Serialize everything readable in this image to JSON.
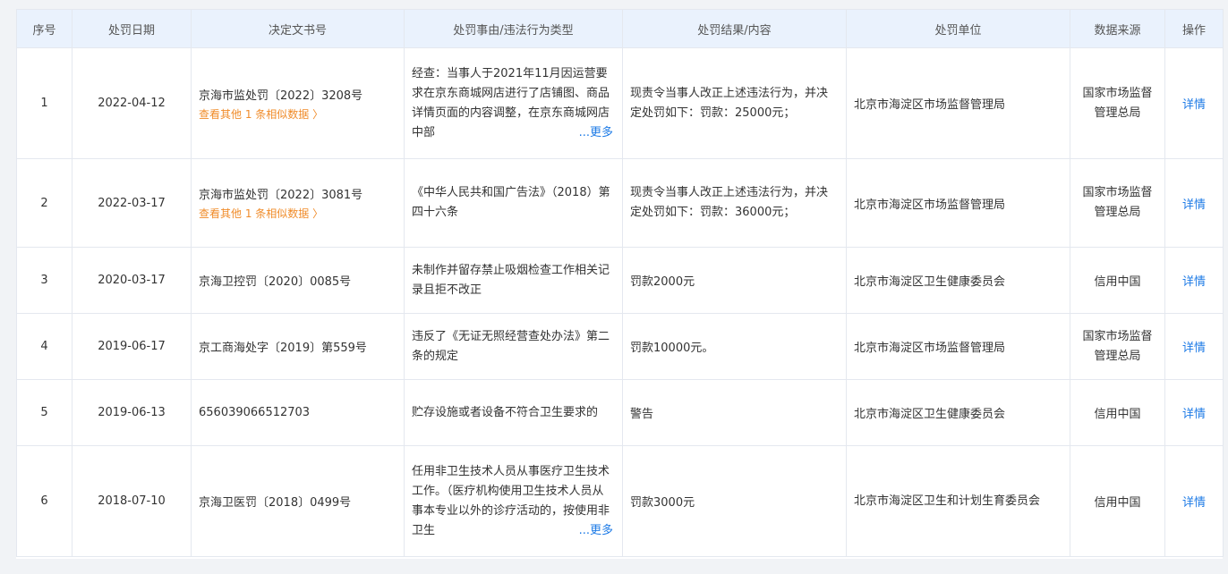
{
  "headers": [
    "序号",
    "处罚日期",
    "决定文书号",
    "处罚事由/违法行为类型",
    "处罚结果/内容",
    "处罚单位",
    "数据来源",
    "操作"
  ],
  "rows": [
    {
      "no": "1",
      "date": "2022-04-12",
      "doc": "京海市监处罚〔2022〕3208号",
      "doc_sub": "查看其他 1 条相似数据 〉",
      "reason": "经查：当事人于2021年11月因运营要求在京东商城网店进行了店铺图、商品详情页面的内容调整，在京东商城网店中部",
      "reason_more": "...更多",
      "result": "现责令当事人改正上述违法行为，并决定处罚如下：罚款：25000元；",
      "unit": "北京市海淀区市场监督管理局",
      "source": "国家市场监督管理总局",
      "action": "详情"
    },
    {
      "no": "2",
      "date": "2022-03-17",
      "doc": "京海市监处罚〔2022〕3081号",
      "doc_sub": "查看其他 1 条相似数据 〉",
      "reason": "《中华人民共和国广告法》（2018）第四十六条",
      "reason_more": "",
      "result": "现责令当事人改正上述违法行为，并决定处罚如下：罚款：36000元；",
      "unit": "北京市海淀区市场监督管理局",
      "source": "国家市场监督管理总局",
      "action": "详情"
    },
    {
      "no": "3",
      "date": "2020-03-17",
      "doc": "京海卫控罚〔2020〕0085号",
      "doc_sub": "",
      "reason": "未制作并留存禁止吸烟检查工作相关记录且拒不改正",
      "reason_more": "",
      "result": "罚款2000元",
      "unit": "北京市海淀区卫生健康委员会",
      "source": "信用中国",
      "action": "详情"
    },
    {
      "no": "4",
      "date": "2019-06-17",
      "doc": "京工商海处字〔2019〕第559号",
      "doc_sub": "",
      "reason": "违反了《无证无照经营查处办法》第二条的规定",
      "reason_more": "",
      "result": "罚款10000元。",
      "unit": "北京市海淀区市场监督管理局",
      "source": "国家市场监督管理总局",
      "action": "详情"
    },
    {
      "no": "5",
      "date": "2019-06-13",
      "doc": "656039066512703",
      "doc_sub": "",
      "reason": "贮存设施或者设备不符合卫生要求的",
      "reason_more": "",
      "result": "警告",
      "unit": "北京市海淀区卫生健康委员会",
      "source": "信用中国",
      "action": "详情"
    },
    {
      "no": "6",
      "date": "2018-07-10",
      "doc": "京海卫医罚〔2018〕0499号",
      "doc_sub": "",
      "reason": "任用非卫生技术人员从事医疗卫生技术工作。（医疗机构使用卫生技术人员从事本专业以外的诊疗活动的，按使用非卫生",
      "reason_more": "...更多",
      "result": "罚款3000元",
      "unit": "北京市海淀区卫生和计划生育委员会",
      "source": "信用中国",
      "action": "详情"
    }
  ]
}
